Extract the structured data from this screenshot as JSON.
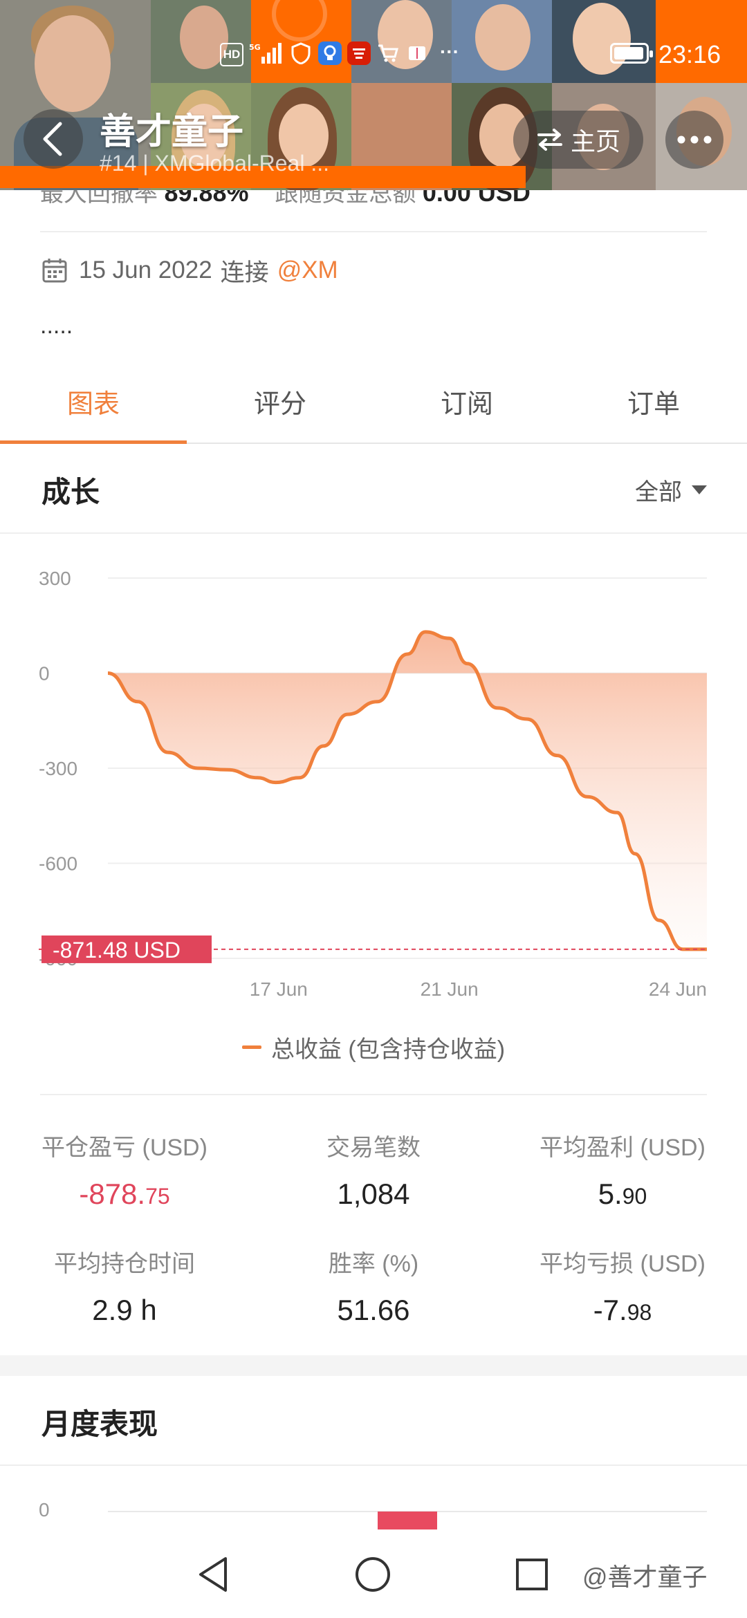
{
  "status_bar": {
    "hd": "HD",
    "network": "5G",
    "dots": "···",
    "time": "23:16"
  },
  "header": {
    "title": "善才童子",
    "subtitle": "#14 | XMGlobal-Real ...",
    "home_label": "主页"
  },
  "info": {
    "metrics_partial_label1": "最大回撤率",
    "metrics_partial_value1": "89.88%",
    "metrics_partial_label2": "跟随资金总额",
    "metrics_partial_value2": "0.00 USD",
    "connect_date": "15 Jun 2022",
    "connect_word": "连接",
    "broker": "@XM",
    "description": "....."
  },
  "tabs": [
    {
      "label": "图表",
      "active": true
    },
    {
      "label": "评分",
      "active": false
    },
    {
      "label": "订阅",
      "active": false
    },
    {
      "label": "订单",
      "active": false
    }
  ],
  "growth": {
    "title": "成长",
    "filter": "全部"
  },
  "chart_data": {
    "type": "area",
    "ylim": [
      -900,
      300
    ],
    "yticks": [
      "300",
      "0",
      "-300",
      "-600",
      "-900"
    ],
    "xticks": [
      {
        "label": "17 Jun",
        "x": 0.285
      },
      {
        "label": "21 Jun",
        "x": 0.57
      },
      {
        "label": "24 Jun",
        "x": 1.0
      }
    ],
    "series": [
      {
        "name": "总收益 (包含持仓收益)",
        "color": "#f0803c",
        "x": [
          0,
          0.05,
          0.1,
          0.15,
          0.2,
          0.25,
          0.28,
          0.32,
          0.36,
          0.4,
          0.45,
          0.5,
          0.53,
          0.57,
          0.6,
          0.65,
          0.7,
          0.75,
          0.8,
          0.85,
          0.88,
          0.92,
          0.96,
          1.0
        ],
        "values": [
          0,
          -90,
          -250,
          -300,
          -305,
          -330,
          -345,
          -330,
          -230,
          -130,
          -90,
          60,
          130,
          110,
          30,
          -110,
          -145,
          -260,
          -390,
          -440,
          -570,
          -780,
          -871.48,
          -871.48
        ]
      }
    ],
    "current_value_label": "-871.48 USD",
    "current_value": -871.48
  },
  "stats": [
    {
      "label": "平仓盈亏 (USD)",
      "value_main": "-878.",
      "value_small": "75",
      "negative": true
    },
    {
      "label": "交易笔数",
      "value_main": "1,084",
      "value_small": "",
      "negative": false
    },
    {
      "label": "平均盈利 (USD)",
      "value_main": "5.",
      "value_small": "90",
      "negative": false
    },
    {
      "label": "平均持仓时间",
      "value_main": "2.9 h",
      "value_small": "",
      "negative": false
    },
    {
      "label": "胜率 (%)",
      "value_main": "51.66",
      "value_small": "",
      "negative": false
    },
    {
      "label": "平均亏损 (USD)",
      "value_main": "-7.",
      "value_small": "98",
      "negative": false
    }
  ],
  "monthly": {
    "title": "月度表现",
    "ytick": "0"
  },
  "watermark": "@善才童子",
  "colors": {
    "accent": "#f0803c",
    "negative": "#e0455b",
    "header_orange": "#ff6a00"
  }
}
